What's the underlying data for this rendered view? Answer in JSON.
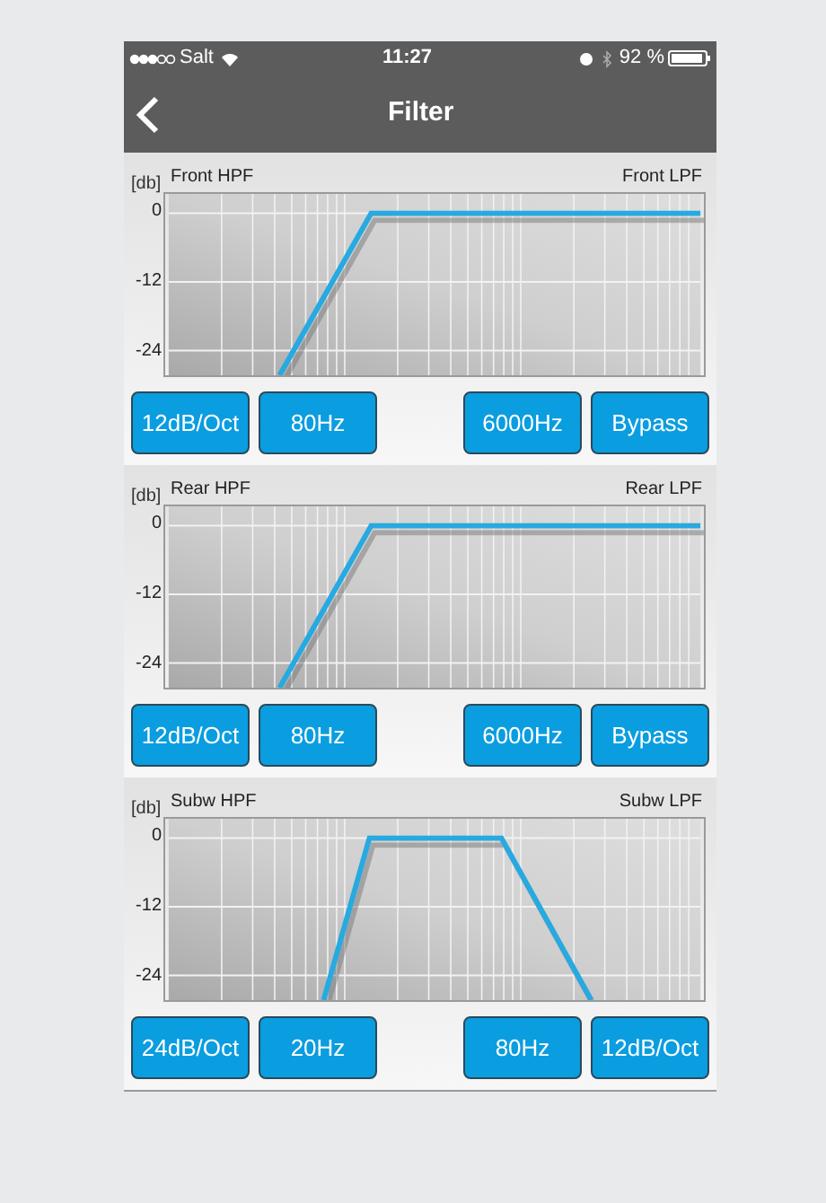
{
  "status_bar": {
    "carrier": "Salt",
    "time": "11:27",
    "battery": "92 %"
  },
  "nav": {
    "title": "Filter"
  },
  "panels": [
    {
      "kind": "highpass",
      "unit": "[db]",
      "hpf_label": "Front HPF",
      "lpf_label": "Front LPF",
      "yticks": [
        "0",
        "-12",
        "-24"
      ],
      "buttons": [
        "12dB/Oct",
        "80Hz",
        "6000Hz",
        "Bypass"
      ]
    },
    {
      "kind": "highpass",
      "unit": "[db]",
      "hpf_label": "Rear HPF",
      "lpf_label": "Rear LPF",
      "yticks": [
        "0",
        "-12",
        "-24"
      ],
      "buttons": [
        "12dB/Oct",
        "80Hz",
        "6000Hz",
        "Bypass"
      ]
    },
    {
      "kind": "bandpass",
      "unit": "[db]",
      "hpf_label": "Subw HPF",
      "lpf_label": "Subw LPF",
      "yticks": [
        "0",
        "-12",
        "-24"
      ],
      "buttons": [
        "24dB/Oct",
        "20Hz",
        "80Hz",
        "12dB/Oct"
      ]
    }
  ]
}
